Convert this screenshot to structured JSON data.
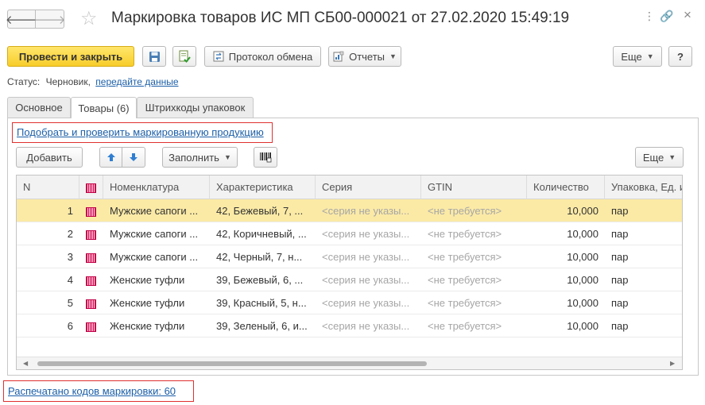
{
  "window": {
    "title": "Маркировка товаров ИС МП СБ00-000021 от 27.02.2020 15:49:19",
    "back_symbol": "🡐",
    "forward_symbol": "🡒",
    "favorite_symbol": "☆",
    "menu_symbol": "⋮",
    "link_symbol": "🔗",
    "close_symbol": "×"
  },
  "toolbar": {
    "post_and_close": "Провести и закрыть",
    "exchange_protocol": "Протокол обмена",
    "reports": "Отчеты",
    "more": "Еще",
    "help": "?"
  },
  "status": {
    "label": "Статус:",
    "value": "Черновик,",
    "action_link": "передайте данные"
  },
  "tabs": [
    {
      "label": "Основное"
    },
    {
      "label": "Товары (6)"
    },
    {
      "label": "Штрихкоды упаковок"
    }
  ],
  "goods": {
    "select_link": "Подобрать и проверить маркированную продукцию",
    "add": "Добавить",
    "fill": "Заполнить",
    "more": "Еще",
    "columns": {
      "n": "N",
      "nomenclature": "Номенклатура",
      "characteristic": "Характеристика",
      "series": "Серия",
      "gtin": "GTIN",
      "quantity": "Количество",
      "package": "Упаковка, Ед. и"
    },
    "rows": [
      {
        "n": "1",
        "nomenclature": "Мужские сапоги ...",
        "characteristic": "42, Бежевый, 7, ...",
        "series": "<серия не указы...",
        "gtin": "<не требуется>",
        "quantity": "10,000",
        "package": "пар"
      },
      {
        "n": "2",
        "nomenclature": "Мужские сапоги ...",
        "characteristic": "42, Коричневый, ...",
        "series": "<серия не указы...",
        "gtin": "<не требуется>",
        "quantity": "10,000",
        "package": "пар"
      },
      {
        "n": "3",
        "nomenclature": "Мужские сапоги ...",
        "characteristic": "42, Черный, 7, н...",
        "series": "<серия не указы...",
        "gtin": "<не требуется>",
        "quantity": "10,000",
        "package": "пар"
      },
      {
        "n": "4",
        "nomenclature": "Женские туфли",
        "characteristic": "39, Бежевый, 6, ...",
        "series": "<серия не указы...",
        "gtin": "<не требуется>",
        "quantity": "10,000",
        "package": "пар"
      },
      {
        "n": "5",
        "nomenclature": "Женские туфли",
        "characteristic": "39, Красный, 5, н...",
        "series": "<серия не указы...",
        "gtin": "<не требуется>",
        "quantity": "10,000",
        "package": "пар"
      },
      {
        "n": "6",
        "nomenclature": "Женские туфли",
        "characteristic": "39, Зеленый, 6, и...",
        "series": "<серия не указы...",
        "gtin": "<не требуется>",
        "quantity": "10,000",
        "package": "пар"
      }
    ]
  },
  "footer": {
    "printed_codes": "Распечатано кодов маркировки: 60"
  },
  "colors": {
    "primary_button": "#f7cd2a",
    "selected_row": "#fbeaa6",
    "link": "#1c5fa8",
    "highlight_frame": "#e03030"
  }
}
